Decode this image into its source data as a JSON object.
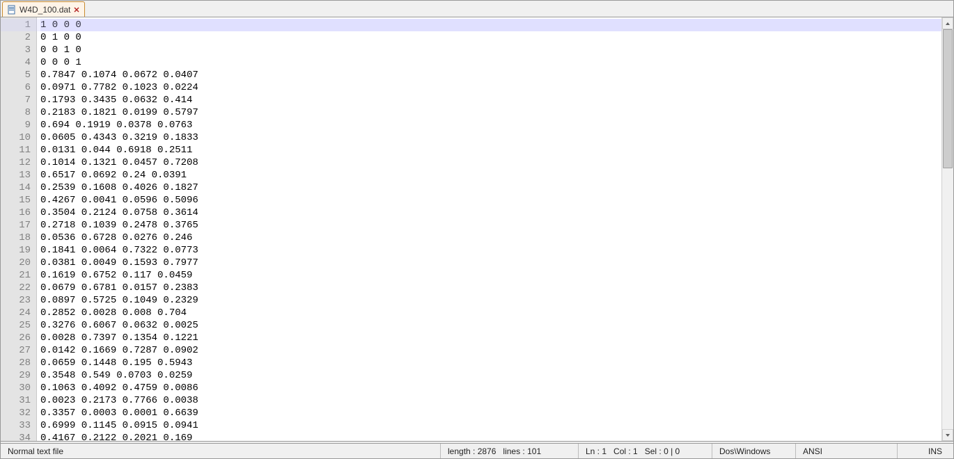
{
  "tab": {
    "filename": "W4D_100.dat",
    "icon": "file-icon",
    "close": "close-icon"
  },
  "editor": {
    "current_line_index": 0,
    "lines": [
      "1 0 0 0",
      "0 1 0 0",
      "0 0 1 0",
      "0 0 0 1",
      "0.7847 0.1074 0.0672 0.0407",
      "0.0971 0.7782 0.1023 0.0224",
      "0.1793 0.3435 0.0632 0.414",
      "0.2183 0.1821 0.0199 0.5797",
      "0.694 0.1919 0.0378 0.0763",
      "0.0605 0.4343 0.3219 0.1833",
      "0.0131 0.044 0.6918 0.2511",
      "0.1014 0.1321 0.0457 0.7208",
      "0.6517 0.0692 0.24 0.0391",
      "0.2539 0.1608 0.4026 0.1827",
      "0.4267 0.0041 0.0596 0.5096",
      "0.3504 0.2124 0.0758 0.3614",
      "0.2718 0.1039 0.2478 0.3765",
      "0.0536 0.6728 0.0276 0.246",
      "0.1841 0.0064 0.7322 0.0773",
      "0.0381 0.0049 0.1593 0.7977",
      "0.1619 0.6752 0.117 0.0459",
      "0.0679 0.6781 0.0157 0.2383",
      "0.0897 0.5725 0.1049 0.2329",
      "0.2852 0.0028 0.008 0.704",
      "0.3276 0.6067 0.0632 0.0025",
      "0.0028 0.7397 0.1354 0.1221",
      "0.0142 0.1669 0.7287 0.0902",
      "0.0659 0.1448 0.195 0.5943",
      "0.3548 0.549 0.0703 0.0259",
      "0.1063 0.4092 0.4759 0.0086",
      "0.0023 0.2173 0.7766 0.0038",
      "0.3357 0.0003 0.0001 0.6639",
      "0.6999 0.1145 0.0915 0.0941",
      "0.4167 0.2122 0.2021 0.169"
    ]
  },
  "status": {
    "filetype": "Normal text file",
    "length_label": "length : 2876",
    "lines_label": "lines : 101",
    "ln_label": "Ln : 1",
    "col_label": "Col : 1",
    "sel_label": "Sel : 0 | 0",
    "eol": "Dos\\Windows",
    "encoding": "ANSI",
    "insert_mode": "INS"
  }
}
